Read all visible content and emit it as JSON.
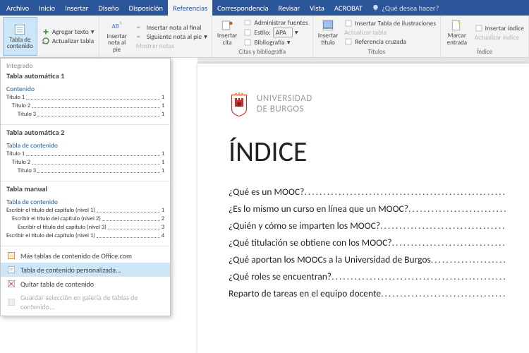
{
  "menu": [
    "Archivo",
    "Inicio",
    "Insertar",
    "Diseño",
    "Disposición",
    "Referencias",
    "Correspondencia",
    "Revisar",
    "Vista",
    "ACROBAT"
  ],
  "active_tab": 5,
  "tell_me": "¿Qué desea hacer?",
  "ribbon": {
    "g0": {
      "big": "Tabla de\ncontenido",
      "i0": "Agregar texto",
      "i1": "Actualizar tabla",
      "label": ""
    },
    "g1": {
      "big": "Insertar\nnota al pie",
      "i0": "Insertar nota al final",
      "i1": "Siguiente nota al pie",
      "i2": "Mostrar notas",
      "label": ""
    },
    "g2": {
      "big": "Insertar\ncita",
      "i0": "Administrar fuentes",
      "i1": "Estilo:",
      "style": "APA",
      "i2": "Bibliografía",
      "label": "Citas y bibliografía"
    },
    "g3": {
      "big": "Insertar\ntítulo",
      "i0": "Insertar Tabla de ilustraciones",
      "i1": "Actualizar tabla",
      "i2": "Referencia cruzada",
      "label": "Títulos"
    },
    "g4": {
      "big": "Marcar\nentrada",
      "i0": "Insertar índice",
      "i1": "Actualizar índice",
      "label": "Índice"
    }
  },
  "dd": {
    "integrado": "Integrado",
    "auto1": "Tabla automática 1",
    "contenido": "Contenido",
    "t1": "Título 1",
    "t2": "Título 2",
    "t3": "Título 3",
    "pg": "1",
    "auto2": "Tabla automática 2",
    "tdc": "Tabla de contenido",
    "manual": "Tabla manual",
    "m1": "Escribir el título del capítulo (nivel 1)",
    "m2": "Escribir el título del capítulo (nivel 2)",
    "m3": "Escribir el título del capítulo (nivel 3)",
    "m1b": "Escribir el título del capítulo (nivel 1)",
    "p2": "2",
    "p3": "3",
    "p4": "4",
    "more": "Más tablas de contenido de Office.com",
    "custom": "Tabla de contenido personalizada...",
    "remove": "Quitar tabla de contenido",
    "save": "Guardar selección en galería de tablas de contenido..."
  },
  "doc": {
    "uni1": "UNIVERSIDAD",
    "uni2": "DE BURGOS",
    "title": "ÍNDICE",
    "rows": [
      "¿Qué es un MOOC? ",
      "¿Es lo mismo un curso en línea que un MOOC?",
      "¿Quién y cómo se imparten los MOOC? ",
      "¿Qué titulación se obtiene con los MOOC?",
      "¿Qué aportan los MOOCs a la Universidad de Burgos",
      "¿Qué roles se encuentran?",
      "Reparto de tareas en el equipo docente"
    ]
  }
}
